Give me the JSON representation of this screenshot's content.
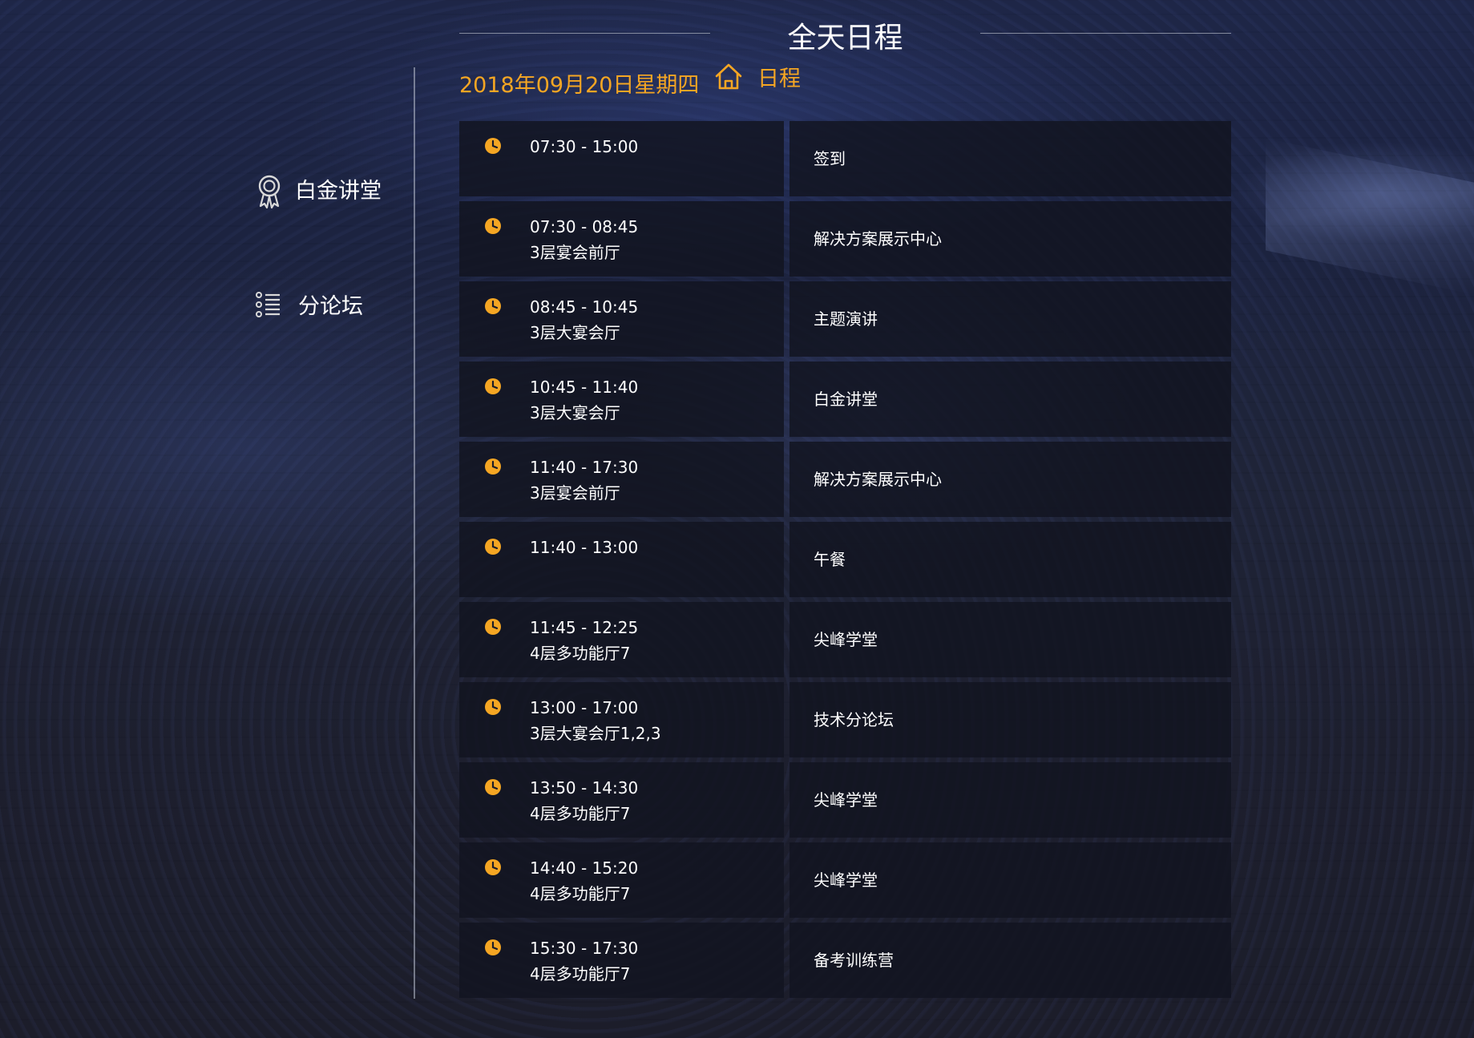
{
  "header": {
    "title": "全天日程",
    "date": "2018年09月20日星期四"
  },
  "sidebar": {
    "items": [
      {
        "label": "日程",
        "icon": "home-icon",
        "active": true
      },
      {
        "label": "白金讲堂",
        "icon": "award-ribbon-icon",
        "active": false
      },
      {
        "label": "分论坛",
        "icon": "list-icon",
        "active": false
      }
    ]
  },
  "colors": {
    "accent": "#f5a623",
    "text": "#ffffff",
    "cell_background": "#121420",
    "divider": "#bec3d2"
  },
  "schedule": {
    "rows": [
      {
        "time": "07:30 - 15:00",
        "location": "",
        "event": "签到"
      },
      {
        "time": "07:30 - 08:45",
        "location": "3层宴会前厅",
        "event": "解决方案展示中心"
      },
      {
        "time": "08:45 - 10:45",
        "location": "3层大宴会厅",
        "event": "主题演讲"
      },
      {
        "time": "10:45 - 11:40",
        "location": "3层大宴会厅",
        "event": "白金讲堂"
      },
      {
        "time": "11:40 - 17:30",
        "location": "3层宴会前厅",
        "event": "解决方案展示中心"
      },
      {
        "time": "11:40 - 13:00",
        "location": "",
        "event": "午餐"
      },
      {
        "time": "11:45 - 12:25",
        "location": "4层多功能厅7",
        "event": "尖峰学堂"
      },
      {
        "time": "13:00 - 17:00",
        "location": "3层大宴会厅1,2,3",
        "event": "技术分论坛"
      },
      {
        "time": "13:50 - 14:30",
        "location": "4层多功能厅7",
        "event": "尖峰学堂"
      },
      {
        "time": "14:40 - 15:20",
        "location": "4层多功能厅7",
        "event": "尖峰学堂"
      },
      {
        "time": "15:30 - 17:30",
        "location": "4层多功能厅7",
        "event": "备考训练营"
      }
    ]
  }
}
